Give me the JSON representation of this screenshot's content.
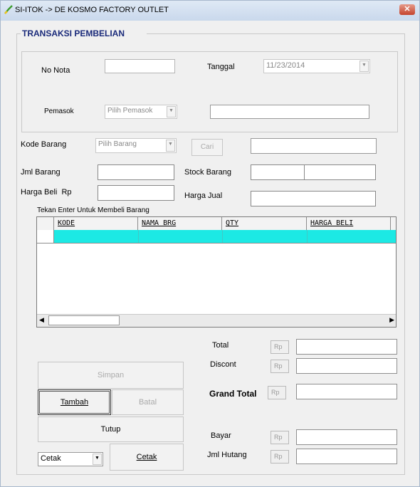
{
  "window": {
    "title": "SI-ITOK -> DE KOSMO FACTORY OUTLET",
    "close_glyph": "✕"
  },
  "form": {
    "group_title": "TRANSAKSI PEMBELIAN",
    "no_nota_label": "No Nota",
    "no_nota_value": "",
    "tanggal_label": "Tanggal",
    "tanggal_value": "11/23/2014",
    "pemasok_label": "Pemasok",
    "pemasok_select": "Pilih Pemasok",
    "pemasok_name": "",
    "kode_barang_label": "Kode Barang",
    "kode_barang_select": "Pilih Barang",
    "cari_button": "Cari",
    "kode_barang_name": "",
    "jml_barang_label": "Jml Barang",
    "jml_barang_value": "",
    "stock_barang_label": "Stock Barang",
    "harga_beli_label": "Harga Beli",
    "harga_beli_unit": "Rp",
    "harga_beli_value": "",
    "harga_jual_label": "Harga Jual",
    "harga_jual_value": "",
    "hint": "Tekan Enter Untuk Membeli Barang"
  },
  "grid": {
    "columns": [
      "KODE",
      "NAMA BRG",
      "QTY",
      "HARGA BELI"
    ],
    "selected_row_color": "#1ce9e4"
  },
  "totals": {
    "total_label": "Total",
    "discount_label": "Discont",
    "grand_total_label": "Grand Total",
    "bayar_label": "Bayar",
    "jml_hutang_label": "Jml Hutang",
    "currency": "Rp"
  },
  "buttons": {
    "simpan": "Simpan",
    "tambah": "Tambah",
    "batal": "Batal",
    "tutup": "Tutup",
    "cetak_select": "Cetak",
    "cetak": "Cetak"
  }
}
